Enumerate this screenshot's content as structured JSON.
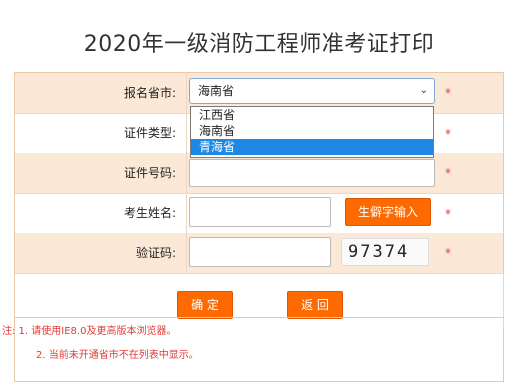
{
  "title": "2020年一级消防工程师准考证打印",
  "fields": {
    "province": {
      "label": "报名省市:",
      "value": "海南省"
    },
    "id_type": {
      "label": "证件类型:"
    },
    "id_number": {
      "label": "证件号码:"
    },
    "name": {
      "label": "考生姓名:"
    },
    "captcha": {
      "label": "验证码:",
      "code": "97374"
    }
  },
  "required_mark": "*",
  "dropdown_options": [
    "江西省",
    "海南省",
    "青海省"
  ],
  "dropdown_selected_index": 2,
  "buttons": {
    "rare_char": "生僻字输入",
    "confirm": "确 定",
    "back": "返 回"
  },
  "notes": {
    "line1": "注: 1. 请使用IE8.0及更高版本浏览器。",
    "line2": "2. 当前未开通省市不在列表中显示。"
  },
  "colors": {
    "accent": "#ff6a00",
    "row_bg": "#fbe8d7",
    "required": "#e53935",
    "selected": "#1e88e5"
  }
}
